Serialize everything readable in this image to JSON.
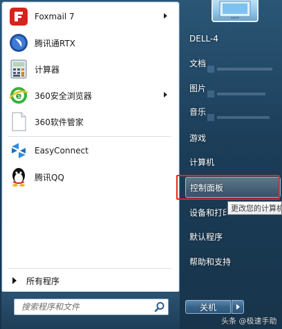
{
  "programs": [
    {
      "label": "Foxmail 7",
      "icon": "foxmail-icon",
      "has_submenu": true
    },
    {
      "label": "腾讯通RTX",
      "icon": "rtx-icon",
      "has_submenu": false
    },
    {
      "label": "计算器",
      "icon": "calculator-icon",
      "has_submenu": false
    },
    {
      "label": "360安全浏览器",
      "icon": "360-browser-icon",
      "has_submenu": true
    },
    {
      "label": "360软件管家",
      "icon": "document-icon",
      "has_submenu": false
    },
    {
      "label": "EasyConnect",
      "icon": "easyconnect-icon",
      "has_submenu": false
    },
    {
      "label": "腾讯QQ",
      "icon": "qq-penguin-icon",
      "has_submenu": false
    }
  ],
  "all_programs_label": "所有程序",
  "search": {
    "placeholder": "搜索程序和文件"
  },
  "right_items": [
    {
      "label": "DELL-4"
    },
    {
      "label": "文档"
    },
    {
      "label": "图片"
    },
    {
      "label": "音乐"
    },
    {
      "label": "游戏"
    },
    {
      "label": "计算机"
    },
    {
      "label": "控制面板",
      "highlighted": true
    },
    {
      "label": "设备和打印"
    },
    {
      "label": "默认程序"
    },
    {
      "label": "帮助和支持"
    }
  ],
  "tooltip": "更改您的计算机",
  "shutdown": {
    "label": "关机"
  },
  "watermark": {
    "prefix": "头条",
    "name": "极速手助"
  },
  "colors": {
    "highlight_outline": "#e8231b",
    "menu_blue": "#2b5676"
  }
}
